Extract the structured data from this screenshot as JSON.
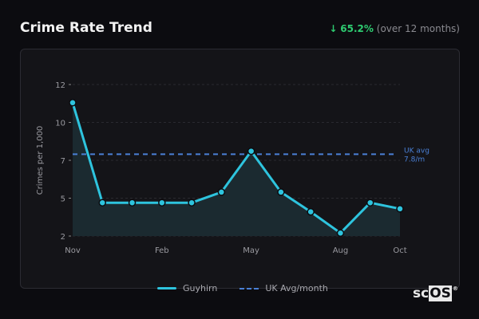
{
  "header": {
    "title": "Crime Rate Trend",
    "arrow": "↓",
    "change_pct": "65.2%",
    "change_period": "(over 12 months)"
  },
  "chart_data": {
    "type": "line",
    "title": "Crime Rate Trend",
    "ylabel": "Crimes per 1,000",
    "xlabel": "",
    "x": [
      "Nov",
      "Dec",
      "Jan",
      "Feb",
      "Mar",
      "Apr",
      "May",
      "Jun",
      "Jul",
      "Aug",
      "Sep",
      "Oct"
    ],
    "x_tick_labels": [
      {
        "index": 0,
        "label": "Nov"
      },
      {
        "index": 3,
        "label": "Feb"
      },
      {
        "index": 6,
        "label": "May"
      },
      {
        "index": 9,
        "label": "Aug"
      },
      {
        "index": 11,
        "label": "Oct"
      }
    ],
    "y_ticks": [
      {
        "value": 12,
        "label": "12"
      },
      {
        "value": 9.5,
        "label": "10"
      },
      {
        "value": 7,
        "label": "7"
      },
      {
        "value": 4.5,
        "label": "5"
      },
      {
        "value": 2,
        "label": "2"
      }
    ],
    "ylim": [
      2,
      12
    ],
    "grid": true,
    "series": [
      {
        "name": "Guyhirn",
        "color": "#2ec4de",
        "values": [
          10.8,
          4.2,
          4.2,
          4.2,
          4.2,
          4.9,
          7.6,
          4.9,
          3.6,
          2.2,
          4.2,
          3.8
        ]
      }
    ],
    "reference_line": {
      "name": "UK Avg/month",
      "value": 7.4,
      "color": "#4a80d6",
      "label_line1": "UK avg",
      "label_line2": "7.8/m"
    },
    "legend": {
      "placement": "bottom",
      "entries": [
        "Guyhirn",
        "UK Avg/month"
      ]
    }
  },
  "brand": {
    "prefix": "sc",
    "boxed": "OS",
    "mark": "®"
  }
}
